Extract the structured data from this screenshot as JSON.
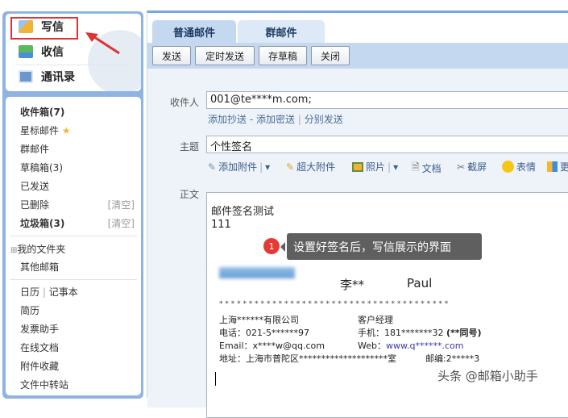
{
  "sidebar": {
    "top": [
      {
        "label": "写信",
        "icon": "pencil-icon"
      },
      {
        "label": "收信",
        "icon": "inbox-download-icon"
      },
      {
        "label": "通讯录",
        "icon": "contacts-icon"
      }
    ],
    "folders": [
      "收件箱(7)",
      "星标邮件",
      "群邮件",
      "草稿箱(3)",
      "已发送",
      "已删除",
      "垃圾箱(3)"
    ],
    "clear_label": "[清空]",
    "my_folders": "我的文件夹",
    "other_mailbox": "其他邮箱",
    "calendar": "日历",
    "notepad": "记事本",
    "tools": [
      "简历",
      "发票助手",
      "在线文档",
      "附件收藏",
      "文件中转站"
    ]
  },
  "tabs": [
    "普通邮件",
    "群邮件"
  ],
  "toolbar": {
    "send": "发送",
    "scheduled": "定时发送",
    "draft": "存草稿",
    "close": "关闭"
  },
  "form": {
    "to_label": "收件人",
    "to_value": "001@te****m.com;",
    "add_cc": "添加抄送",
    "add_bcc": "添加密送",
    "separate": "分别发送",
    "dash": "-",
    "pipe": "|",
    "subject_label": "主题",
    "subject_value": "个性签名",
    "attach": "添加附件",
    "big_attach": "超大附件",
    "photo": "照片",
    "doc": "文档",
    "screenshot": "截屏",
    "emoji": "表情",
    "more": "更",
    "body_label": "正文"
  },
  "body": {
    "line1": "邮件签名测试",
    "line2": "111",
    "name_cn": "李**",
    "name_en": "Paul",
    "stars": "* * * * * * * * * * * * * * * * * * * * * * * * * * * * * * * * * * * * * * *",
    "company": "上海******有限公司",
    "title": "客户经理",
    "phone": "电话：021-5******97",
    "mobile": "手机：181*******32",
    "same": "(**同号)",
    "email": "Email：x****w@qq.com",
    "web_label": "Web：",
    "web": "www.q******.com",
    "address": "地址：上海市普陀区********************室",
    "zip": "邮编:2*****3"
  },
  "annotation": {
    "number": "1",
    "text": "设置好签名后，写信展示的界面"
  },
  "watermark": "头条 @邮箱小助手",
  "colors": {
    "accent": "#7aa7dc",
    "highlight": "#e03232",
    "link": "#3a3aa8"
  }
}
